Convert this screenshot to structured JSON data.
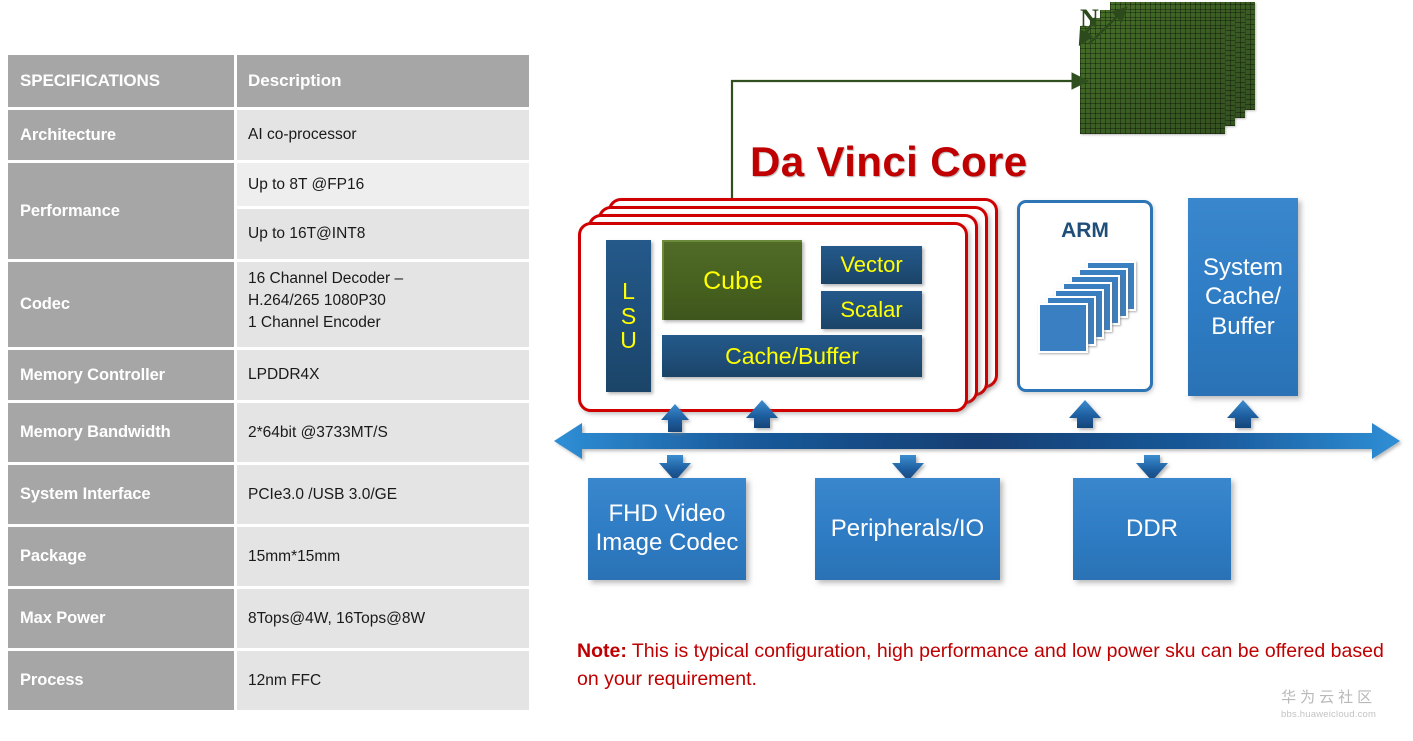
{
  "spec_table": {
    "header": {
      "col1": "SPECIFICATIONS",
      "col2": "Description"
    },
    "rows": [
      {
        "key": "Architecture",
        "values": [
          "AI co-processor"
        ]
      },
      {
        "key": "Performance",
        "values": [
          "Up to 8T @FP16",
          "Up to 16T@INT8"
        ]
      },
      {
        "key": "Codec",
        "values": [
          "16 Channel Decoder –",
          "H.264/265 1080P30",
          "1 Channel Encoder"
        ]
      },
      {
        "key": "Memory Controller",
        "values": [
          "LPDDR4X"
        ]
      },
      {
        "key": "Memory Bandwidth",
        "values": [
          "2*64bit @3733MT/S"
        ]
      },
      {
        "key": "System Interface",
        "values": [
          "PCIe3.0 /USB 3.0/GE"
        ]
      },
      {
        "key": "Package",
        "values": [
          "15mm*15mm"
        ]
      },
      {
        "key": "Max Power",
        "values": [
          "8Tops@4W, 16Tops@8W"
        ]
      },
      {
        "key": "Process",
        "values": [
          "12nm FFC"
        ]
      }
    ]
  },
  "diagram": {
    "title": "Da Vinci Core",
    "matrix": {
      "dimension_label": "N"
    },
    "core_blocks": {
      "lsu_l": "L",
      "lsu_s": "S",
      "lsu_u": "U",
      "cube": "Cube",
      "vector": "Vector",
      "scalar": "Scalar",
      "cache_buffer": "Cache/Buffer"
    },
    "arm": {
      "label": "ARM"
    },
    "system_cache": {
      "line1": "System",
      "line2": "Cache/",
      "line3": "Buffer"
    },
    "bottom_blocks": {
      "fhd_line1": "FHD Video",
      "fhd_line2": "Image Codec",
      "peripherals": "Peripherals/IO",
      "ddr": "DDR"
    }
  },
  "note": {
    "label": "Note:",
    "text": " This is typical configuration, high performance and low power sku can be offered based on your requirement."
  },
  "watermark": {
    "cn": "华为云社区",
    "url": "bbs.huaweicloud.com"
  },
  "colors": {
    "table_key_bg": "#a6a6a6",
    "table_val_bg": "#e4e4e4",
    "core_red": "#d00000",
    "title_red": "#c00000",
    "block_navy": "#1f4e79",
    "cube_green": "#4a6323",
    "matrix_green": "#3b5e24",
    "block_blue": "#2e7cc4",
    "arm_border": "#2e75b6",
    "accent_yellow": "#ffff00"
  }
}
